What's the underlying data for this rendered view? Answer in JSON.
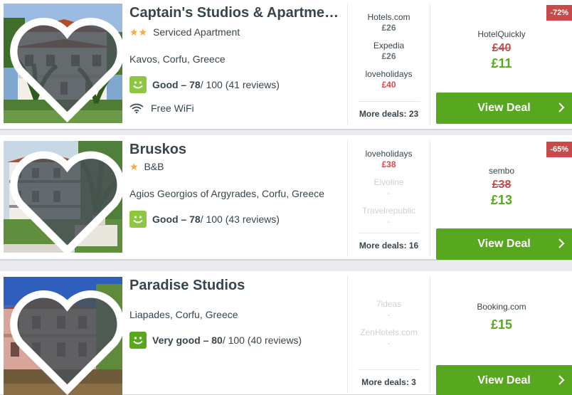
{
  "hotels": [
    {
      "name": "Captain's Studios & Apartme…",
      "stars": "★★",
      "category": "Serviced Apartment",
      "location": "Kavos, Corfu, Greece",
      "rating_label": "Good – 78",
      "rating_suffix": " / 100 (41 reviews)",
      "amenity": "Free WiFi",
      "deals": [
        {
          "site": "Hotels.com",
          "price": "£26"
        },
        {
          "site": "Expedia",
          "price": "£26"
        },
        {
          "site": "loveholidays",
          "price": "£40"
        }
      ],
      "more_deals": "More deals: 23",
      "discount": "-72%",
      "provider": "HotelQuickly",
      "old_price": "£40",
      "price": "£11",
      "cta": "View Deal"
    },
    {
      "name": "Bruskos",
      "stars": "★",
      "category": "B&B",
      "location": "Agios Georgios of Argyrades, Corfu, Greece",
      "rating_label": "Good – 78",
      "rating_suffix": " / 100 (43 reviews)",
      "deals": [
        {
          "site": "loveholidays",
          "price": "£38"
        },
        {
          "site": "Elvoline",
          "price": "-"
        },
        {
          "site": "Travelrepublic",
          "price": "-"
        }
      ],
      "more_deals": "More deals: 16",
      "discount": "-65%",
      "provider": "sembo",
      "old_price": "£38",
      "price": "£13",
      "cta": "View Deal"
    },
    {
      "name": "Paradise Studios",
      "location": "Liapades, Corfu, Greece",
      "rating_label": "Very good – 80",
      "rating_suffix": " / 100 (40 reviews)",
      "deals": [
        {
          "site": "7ideas",
          "price": "-"
        },
        {
          "site": "ZenHotels.com",
          "price": "-"
        }
      ],
      "more_deals": "More deals: 3",
      "provider": "Booking.com",
      "price": "£15",
      "cta": "View Deal"
    }
  ],
  "colors": {
    "accent_green": "#58a81f",
    "rating_good": "#8dc63f",
    "strike_red": "#c94a4a",
    "star": "#f6ab3f"
  }
}
